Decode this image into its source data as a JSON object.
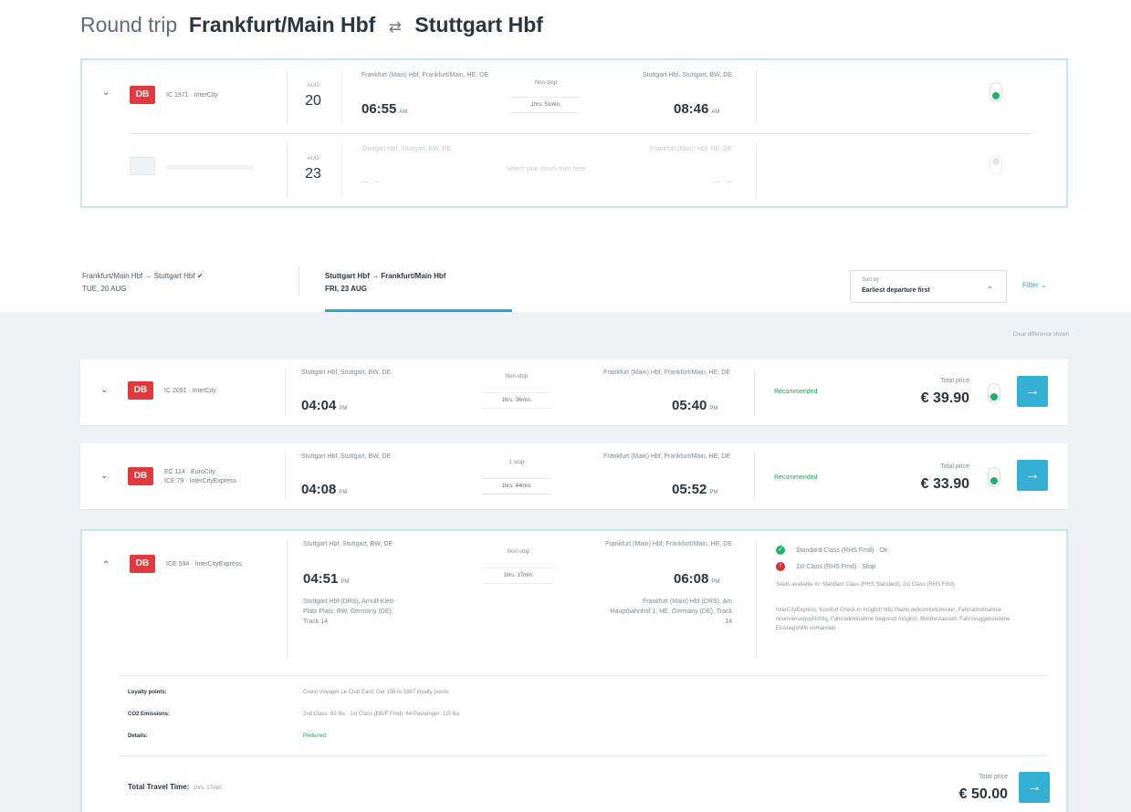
{
  "header": {
    "prefix": "Round trip",
    "from": "Frankfurt/Main Hbf",
    "swap_icon": "⇄",
    "to": "Stuttgart Hbf"
  },
  "summary": {
    "outbound": {
      "train": "IC 1971 · InterCity",
      "month": "AUG",
      "day": "20",
      "from_place": "Frankfurt (Main) Hbf, Frankfurt/Main, HE, DE",
      "dep_time": "06:55",
      "dep_period": "AM",
      "stops": "Non-stop",
      "duration": "1hrs. 51min.",
      "to_place": "Stuttgart Hbf, Stuttgart, BW, DE",
      "arr_time": "08:46",
      "arr_period": "AM"
    },
    "return": {
      "month": "AUG",
      "day": "23",
      "from_place": "Stuttgart Hbf, Stuttgart, BW, DE",
      "dep_time": "— : —",
      "prompt": "Select your return train here",
      "to_place": "Frankfurt (Main) Hbf, HE, DE",
      "arr_time": "— : —"
    }
  },
  "tabs": {
    "leg1_route": "Frankfurt/Main Hbf  →  Stuttgart Hbf  ✔",
    "leg1_date": "TUE, 20 AUG",
    "leg2_route": "Stuttgart Hbf  →  Frankfurt/Main Hbf",
    "leg2_date": "FRI, 23 AUG",
    "sort_label": "Sort by",
    "sort_value": "Earliest departure first",
    "filter": "Filter  ⌄"
  },
  "results_link": "Clear difference shown",
  "results": [
    {
      "train": "IC 2091 · InterCity",
      "from_place": "Stuttgart Hbf, Stuttgart, BW, DE",
      "dep_time": "04:04",
      "dep_period": "PM",
      "stops": "Non-stop",
      "duration": "1hrs. 36min.",
      "to_place": "Frankfurt (Main) Hbf, Frankfurt/Main, HE, DE",
      "arr_time": "05:40",
      "arr_period": "PM",
      "tag": "Recommended",
      "total_label": "Total price",
      "price": "€ 39.90"
    },
    {
      "train_line1": "EC 114 · EuroCity",
      "train_line2": "ICE 79 · InterCityExpress",
      "from_place": "Stuttgart Hbf, Stuttgart, BW, DE",
      "dep_time": "04:08",
      "dep_period": "PM",
      "stops": "1 stop",
      "duration": "1hrs. 44min.",
      "to_place": "Frankfurt (Main) Hbf, Frankfurt/Main, HE, DE",
      "arr_time": "05:52",
      "arr_period": "PM",
      "tag": "Recommended",
      "total_label": "Total price",
      "price": "€ 33.90"
    },
    {
      "train": "ICE 594 · InterCityExpress",
      "from_place": "Stuttgart Hbf, Stuttgart, BW, DE",
      "dep_time": "04:51",
      "dep_period": "PM",
      "dep_station": "Stuttgart Hbf (DRS), Arnulf-Klett-Platz Platz, BW, Germany (DE), Track 14",
      "stops": "Non-stop",
      "duration": "1hrs. 17min.",
      "to_place": "Frankfurt (Main) Hbf, Frankfurt/Main, HE, DE",
      "arr_time": "06:08",
      "arr_period": "PM",
      "arr_station": "Frankfurt (Main) Hbf (DRS), Am Hauptbahnhof 1, HE, Germany (DE), Track 14",
      "class1": "Standard Class (RHS Fmd) · Ok",
      "class2": "1st Class (RHS Fmd) · Stop",
      "note1": "Seats available in: Standard Class (RHS Standard), 1st Class (RHS Fmd)",
      "note2": "InterCityExpress, Komfort Check-in möglich http://bahn.de/komfortcheckin, Fahrradmitnahme reservierungspflichtig, Fahrradmitnahme begrenzt möglich, Bordrestaurant, Fahrzeuggebundene Einstiegshilfe vorhanden",
      "loyalty_label": "Loyalty points:",
      "loyalty_value": "Guest Voyager Le Club Card: Get 156 to 1887 loyalty points",
      "co2_label": "CO2 Emissions:",
      "co2_value": "2nd Class: 82 lbs · 1st Class (DB/F Fmd): 64 Passenger: 115 lbs",
      "details_label": "Details:",
      "details_value": "Preferred",
      "total_time_label": "Total Travel Time:",
      "total_time_value": "1hrs. 17min.",
      "total_label": "Total price",
      "price": "€ 50.00"
    }
  ],
  "icons": {
    "chevron_down": "⌄",
    "chevron_up": "⌃",
    "arrow": "→",
    "db_logo": "DB"
  }
}
